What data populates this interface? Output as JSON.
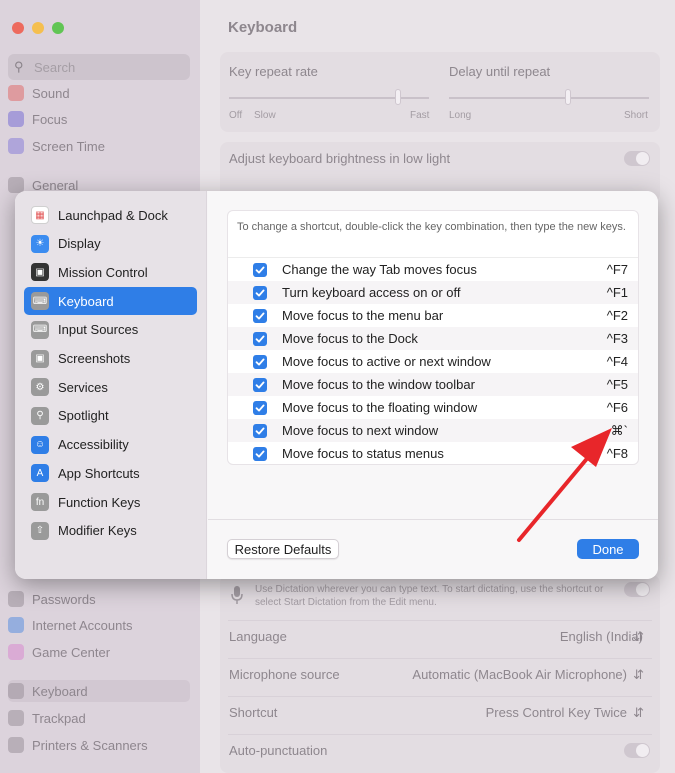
{
  "background": {
    "title": "Keyboard",
    "search_placeholder": "Search",
    "sidebar_items": [
      {
        "label": "Sound",
        "color": "#e06d6d"
      },
      {
        "label": "Focus",
        "color": "#7a6fd6"
      },
      {
        "label": "Screen Time",
        "color": "#8a7fd9"
      },
      {
        "label": "General",
        "color": "#9a929a"
      },
      {
        "label": "Passwords",
        "color": "#9a929a"
      },
      {
        "label": "Internet Accounts",
        "color": "#5b8fe0"
      },
      {
        "label": "Game Center",
        "color": "#d98ad0"
      },
      {
        "label": "Keyboard",
        "color": "#9a929a"
      },
      {
        "label": "Trackpad",
        "color": "#9a929a"
      },
      {
        "label": "Printers & Scanners",
        "color": "#9a929a"
      }
    ],
    "key_repeat_rate": "Key repeat rate",
    "delay_until_repeat": "Delay until repeat",
    "off": "Off",
    "slow": "Slow",
    "fast": "Fast",
    "long": "Long",
    "short": "Short",
    "brightness_label": "Adjust keyboard brightness in low light",
    "dictation_note": "Use Dictation wherever you can type text. To start dictating, use the shortcut or select Start Dictation from the Edit menu.",
    "language_label": "Language",
    "language_value": "English (India)",
    "mic_label": "Microphone source",
    "mic_value": "Automatic (MacBook Air Microphone)",
    "shortcut_label": "Shortcut",
    "shortcut_value": "Press Control Key Twice",
    "autopunct_label": "Auto-punctuation"
  },
  "modal": {
    "sidebar": [
      {
        "label": "Launchpad & Dock",
        "icon": "launchpad-icon",
        "color": "#ffffff"
      },
      {
        "label": "Display",
        "icon": "display-icon",
        "color": "#3b8cf0"
      },
      {
        "label": "Mission Control",
        "icon": "mission-control-icon",
        "color": "#333333"
      },
      {
        "label": "Keyboard",
        "icon": "keyboard-icon",
        "color": "#9a9a9a"
      },
      {
        "label": "Input Sources",
        "icon": "input-sources-icon",
        "color": "#9a9a9a"
      },
      {
        "label": "Screenshots",
        "icon": "screenshots-icon",
        "color": "#9a9a9a"
      },
      {
        "label": "Services",
        "icon": "services-icon",
        "color": "#9a9a9a"
      },
      {
        "label": "Spotlight",
        "icon": "spotlight-icon",
        "color": "#9a9a9a"
      },
      {
        "label": "Accessibility",
        "icon": "accessibility-icon",
        "color": "#2f7ee7"
      },
      {
        "label": "App Shortcuts",
        "icon": "app-shortcuts-icon",
        "color": "#2f7ee7"
      },
      {
        "label": "Function Keys",
        "icon": "function-keys-icon",
        "color": "#9a9a9a"
      },
      {
        "label": "Modifier Keys",
        "icon": "modifier-keys-icon",
        "color": "#9a9a9a"
      }
    ],
    "selected_index": 3,
    "note": "To change a shortcut, double-click the key combination, then type the new keys.",
    "shortcuts": [
      {
        "label": "Change the way Tab moves focus",
        "key": "^F7",
        "checked": true
      },
      {
        "label": "Turn keyboard access on or off",
        "key": "^F1",
        "checked": true
      },
      {
        "label": "Move focus to the menu bar",
        "key": "^F2",
        "checked": true
      },
      {
        "label": "Move focus to the Dock",
        "key": "^F3",
        "checked": true
      },
      {
        "label": "Move focus to active or next window",
        "key": "^F4",
        "checked": true
      },
      {
        "label": "Move focus to the window toolbar",
        "key": "^F5",
        "checked": true
      },
      {
        "label": "Move focus to the floating window",
        "key": "^F6",
        "checked": true
      },
      {
        "label": "Move focus to next window",
        "key": "⌘`",
        "checked": true
      },
      {
        "label": "Move focus to status menus",
        "key": "^F8",
        "checked": true
      }
    ],
    "restore_label": "Restore Defaults",
    "done_label": "Done",
    "accent_color": "#2f7ee7"
  },
  "annotation": {
    "color": "#e8262a"
  }
}
